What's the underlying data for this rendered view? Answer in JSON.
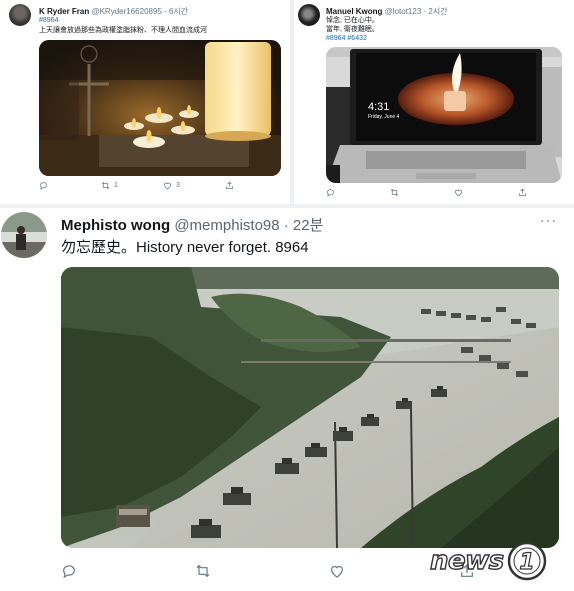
{
  "tweets": [
    {
      "display_name": "K Ryder Fran",
      "handle_time": "@KRyder16620895 · 6시간",
      "hashtag": "#8964",
      "text": "上天讓會放過那些為政權塗脂抹粉、不理人間血流成河",
      "actions": {
        "reply": "",
        "retweet": "1",
        "like": "3",
        "share": ""
      }
    },
    {
      "display_name": "Manuel Kwong",
      "handle_time": "@lotot123 · 2시간",
      "line1": "悼念, 已在心中。",
      "line2": "當年, 衛夜難眠。",
      "hashtags": "#8964 #6432",
      "actions": {
        "reply": "",
        "retweet": "",
        "like": "",
        "share": ""
      },
      "screen_time": "4:31",
      "screen_date": "Friday, June 4"
    },
    {
      "display_name": "Mephisto wong",
      "handle_time": "@memphisto98 · 22분",
      "text": "勿忘歷史。History never forget. 8964",
      "more": "···",
      "actions": {
        "reply": "",
        "retweet": "",
        "like": "",
        "share": ""
      }
    }
  ],
  "watermark": {
    "brand": "news",
    "mark": "1"
  },
  "icons": [
    "reply-icon",
    "retweet-icon",
    "like-icon",
    "share-icon",
    "more-icon"
  ],
  "colors": {
    "secondary_text": "#657786",
    "hashtag": "#1b6fa8",
    "separator": "#eef0f2"
  }
}
